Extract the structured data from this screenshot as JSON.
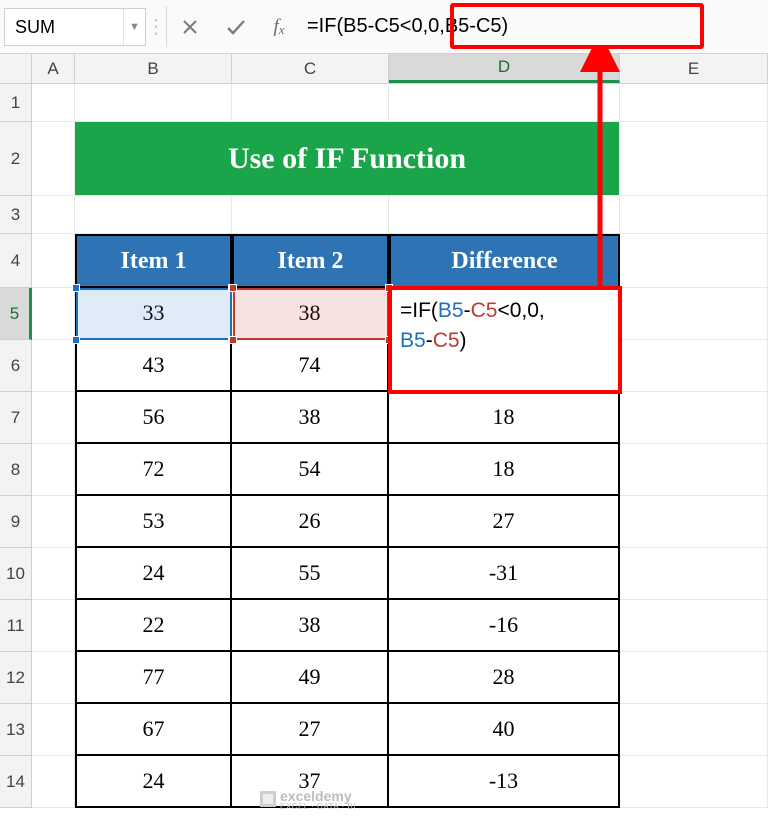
{
  "name_box": "SUM",
  "formula_bar": "=IF(B5-C5<0,0,B5-C5)",
  "columns": [
    "A",
    "B",
    "C",
    "D",
    "E"
  ],
  "active_column": "D",
  "active_row": 5,
  "title": "Use of IF Function",
  "headers": {
    "b": "Item 1",
    "c": "Item 2",
    "d": "Difference"
  },
  "edit_cell": {
    "prefix": "=IF(",
    "ref1": "B5",
    "dash1": "-",
    "ref2": "C5",
    "lt": "<0,0,",
    "ref3": "B5",
    "dash2": "-",
    "ref4": "C5",
    "close": ")"
  },
  "rows": [
    {
      "n": 5,
      "b": "33",
      "c": "38",
      "d": ""
    },
    {
      "n": 6,
      "b": "43",
      "c": "74",
      "d": ""
    },
    {
      "n": 7,
      "b": "56",
      "c": "38",
      "d": "18"
    },
    {
      "n": 8,
      "b": "72",
      "c": "54",
      "d": "18"
    },
    {
      "n": 9,
      "b": "53",
      "c": "26",
      "d": "27"
    },
    {
      "n": 10,
      "b": "24",
      "c": "55",
      "d": "-31"
    },
    {
      "n": 11,
      "b": "22",
      "c": "38",
      "d": "-16"
    },
    {
      "n": 12,
      "b": "77",
      "c": "49",
      "d": "28"
    },
    {
      "n": 13,
      "b": "67",
      "c": "27",
      "d": "40"
    },
    {
      "n": 14,
      "b": "24",
      "c": "37",
      "d": "-13"
    }
  ],
  "watermark": {
    "brand": "exceldemy",
    "tag": "EXCEL · DATA · BI"
  },
  "chart_data": {
    "type": "table",
    "title": "Use of IF Function",
    "columns": [
      "Item 1",
      "Item 2",
      "Difference"
    ],
    "rows": [
      [
        33,
        38,
        null
      ],
      [
        43,
        74,
        null
      ],
      [
        56,
        38,
        18
      ],
      [
        72,
        54,
        18
      ],
      [
        53,
        26,
        27
      ],
      [
        24,
        55,
        -31
      ],
      [
        22,
        38,
        -16
      ],
      [
        77,
        49,
        28
      ],
      [
        67,
        27,
        40
      ],
      [
        24,
        37,
        -13
      ]
    ],
    "formula_in_D5": "=IF(B5-C5<0,0,B5-C5)"
  },
  "colors": {
    "title_bg": "#1aa54a",
    "header_bg": "#2e74b5",
    "callout": "#ff0000",
    "ref_blue": "#1f6fc0",
    "ref_red": "#c0392b"
  }
}
